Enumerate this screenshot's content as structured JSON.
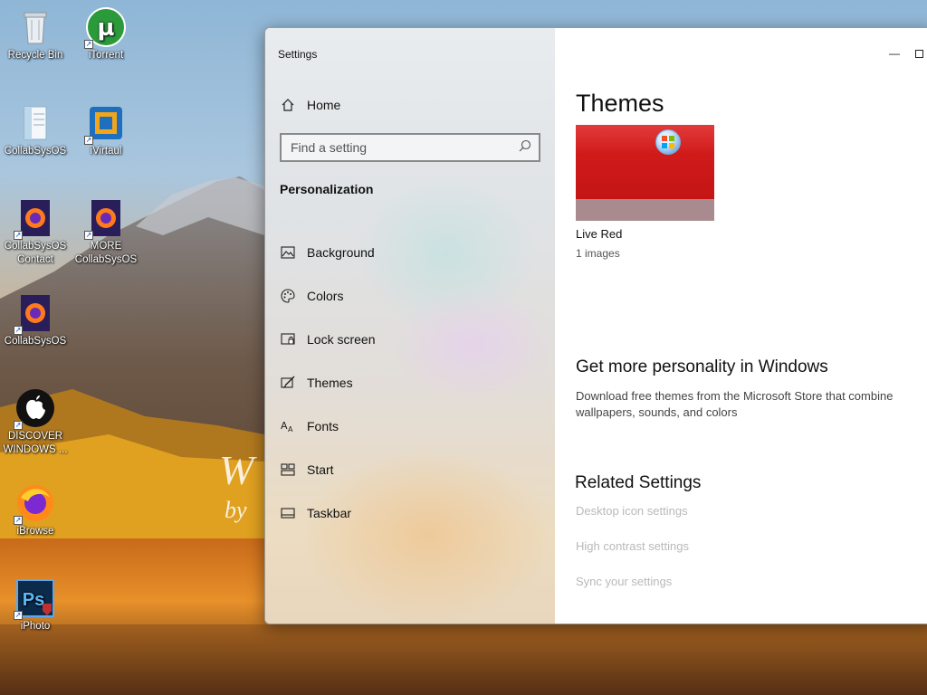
{
  "desktop": {
    "icons": [
      {
        "label": "Recycle Bin",
        "icon": "recycle-bin-icon"
      },
      {
        "label": "iTorrent",
        "icon": "utorrent-icon"
      },
      {
        "label": "CollabSysOS",
        "icon": "notepad-icon"
      },
      {
        "label": "iVirtaul",
        "icon": "virtualbox-icon"
      },
      {
        "label": "CollabSysOS Contact",
        "icon": "firefox-icon"
      },
      {
        "label": "MORE CollabSysOS",
        "icon": "firefox-icon"
      },
      {
        "label": "CollabSysOS",
        "icon": "firefox-icon"
      },
      {
        "label": "DISCOVER WINDOWS ...",
        "icon": "apple-icon"
      },
      {
        "label": "iBrowse",
        "icon": "firefox-icon"
      },
      {
        "label": "iPhoto",
        "icon": "photoshop-icon"
      }
    ]
  },
  "window": {
    "title": "Settings",
    "minimize_glyph": "—"
  },
  "nav": {
    "home_label": "Home",
    "search_placeholder": "Find a setting",
    "section_title": "Personalization",
    "items": [
      {
        "label": "Background",
        "icon": "picture-icon"
      },
      {
        "label": "Colors",
        "icon": "palette-icon"
      },
      {
        "label": "Lock screen",
        "icon": "lock-screen-icon"
      },
      {
        "label": "Themes",
        "icon": "brush-icon"
      },
      {
        "label": "Fonts",
        "icon": "font-icon"
      },
      {
        "label": "Start",
        "icon": "start-icon"
      },
      {
        "label": "Taskbar",
        "icon": "taskbar-icon"
      }
    ]
  },
  "content": {
    "heading": "Themes",
    "theme": {
      "name": "Live Red",
      "count": "1 images"
    },
    "more_heading": "Get more personality in Windows",
    "more_desc": "Download free themes from the Microsoft Store that combine wallpapers, sounds, and colors",
    "related_heading": "Related Settings",
    "related_links": [
      "Desktop icon settings",
      "High contrast settings",
      "Sync your settings"
    ]
  },
  "colors": {
    "theme_red": "#d01a1a",
    "theme_bar": "#a98b8f",
    "link_disabled": "#b9b9b9"
  }
}
